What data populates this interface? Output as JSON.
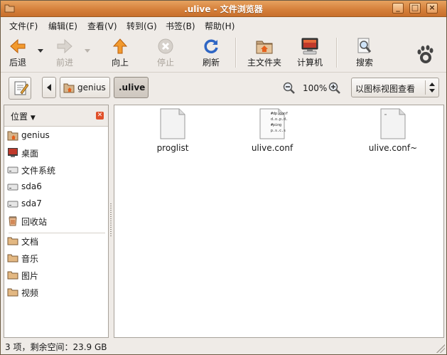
{
  "window": {
    "title": ".ulive - 文件浏览器"
  },
  "menubar": [
    {
      "label": "文件(F)"
    },
    {
      "label": "编辑(E)"
    },
    {
      "label": "查看(V)"
    },
    {
      "label": "转到(G)"
    },
    {
      "label": "书签(B)"
    },
    {
      "label": "帮助(H)"
    }
  ],
  "toolbar": {
    "back": "后退",
    "forward": "前进",
    "up": "向上",
    "stop": "停止",
    "reload": "刷新",
    "home": "主文件夹",
    "computer": "计算机",
    "search": "搜索"
  },
  "location": {
    "crumbs": [
      "genius",
      ".ulive"
    ],
    "zoom": "100%",
    "view_mode": "以图标视图查看"
  },
  "sidebar": {
    "title": "位置",
    "places": [
      {
        "name": "genius",
        "icon": "home-folder-icon"
      },
      {
        "name": "桌面",
        "icon": "desktop-icon"
      },
      {
        "name": "文件系统",
        "icon": "drive-icon"
      },
      {
        "name": "sda6",
        "icon": "drive-icon"
      },
      {
        "name": "sda7",
        "icon": "drive-icon"
      },
      {
        "name": "回收站",
        "icon": "trash-icon"
      }
    ],
    "bookmarks": [
      {
        "name": "文档",
        "icon": "folder-icon"
      },
      {
        "name": "音乐",
        "icon": "folder-icon"
      },
      {
        "name": "图片",
        "icon": "folder-icon"
      },
      {
        "name": "视频",
        "icon": "folder-icon"
      }
    ]
  },
  "files": [
    {
      "name": "proglist",
      "icon": "blank-file-icon"
    },
    {
      "name": "ulive.conf",
      "icon": "text-file-icon",
      "preview": [
        "#dp.conf",
        "d.o.p.d.",
        "#ping",
        "p.s.c.s"
      ]
    },
    {
      "name": "ulive.conf~",
      "icon": "blank-file-icon"
    }
  ],
  "status": {
    "text": "3 项，剩余空间：23.9 GB"
  },
  "colors": {
    "titlebar": "#d5803b",
    "accent": "#e07a1f"
  }
}
